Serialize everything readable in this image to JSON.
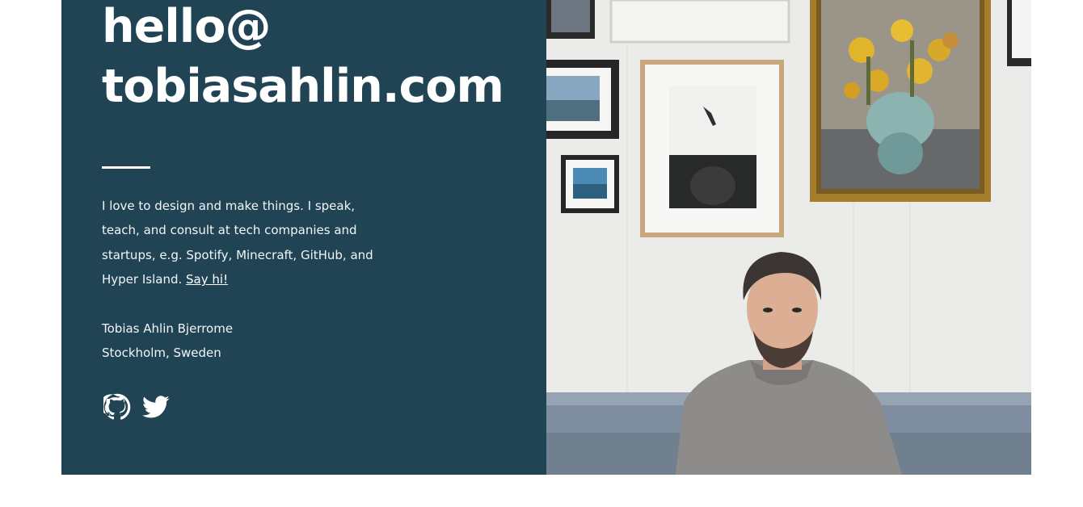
{
  "headline": {
    "line1": "hello@",
    "line2": "tobiasahlin.com"
  },
  "bio": {
    "text": "I love to design and make things. I speak, teach, and consult at tech companies and startups, e.g. Spotify, Minecraft, GitHub, and Hyper Island.",
    "link_label": "Say hi!"
  },
  "contact": {
    "name": "Tobias Ahlin Bjerrome",
    "location": "Stockholm, Sweden"
  },
  "socials": [
    {
      "icon": "github-icon"
    },
    {
      "icon": "twitter-icon"
    }
  ],
  "colors": {
    "panel_background": "#214455",
    "text": "#ffffff"
  }
}
